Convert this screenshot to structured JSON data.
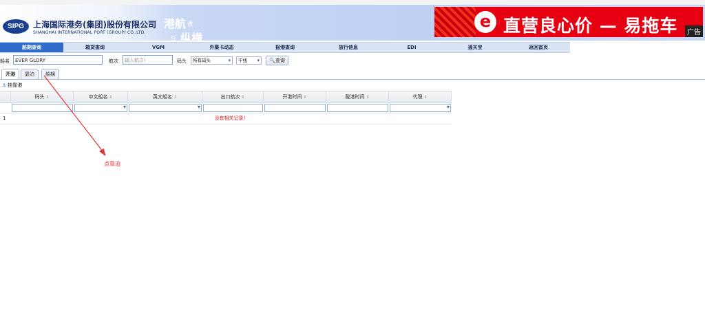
{
  "header": {
    "logo_text": "SIPG",
    "company_cn": "上海国际港务(集团)股份有限公司",
    "company_en": "SHANGHAI INTERNATIONAL PORT (GROUP) CO.,LTD.",
    "slogan": [
      "港航",
      "通",
      "任",
      "纵横"
    ]
  },
  "ad": {
    "icon_letter": "e",
    "text": "直营良心价 — 易拖车",
    "tag": "广告"
  },
  "nav": {
    "items": [
      "船期查询",
      "箱货查询",
      "VGM",
      "外集卡动态",
      "报港查询",
      "放行信息",
      "EDI",
      "通关宝",
      "返回首页"
    ],
    "active": "船期查询"
  },
  "search": {
    "ship_label": "船名",
    "ship_value": "EVER GLORY",
    "voyage_label": "航次",
    "voyage_placeholder": "输入航次!",
    "terminal_label": "码头",
    "terminal_value": "所有码头",
    "line_value": "干线",
    "query_label": "查询"
  },
  "tabs": [
    "开港",
    "靠泊",
    "船期"
  ],
  "grid": {
    "title": "挂靠港",
    "columns": [
      "码头",
      "中文船名",
      "英文船名",
      "出口航次",
      "开港时间",
      "截港时间",
      "代理"
    ],
    "row_number": "1",
    "empty_message": "没有相关记录！"
  },
  "annotation": {
    "text": "点靠泊",
    "color": "#e33333"
  },
  "colors": {
    "nav_active": "#2f6cc9",
    "ad_red": "#e60012"
  }
}
